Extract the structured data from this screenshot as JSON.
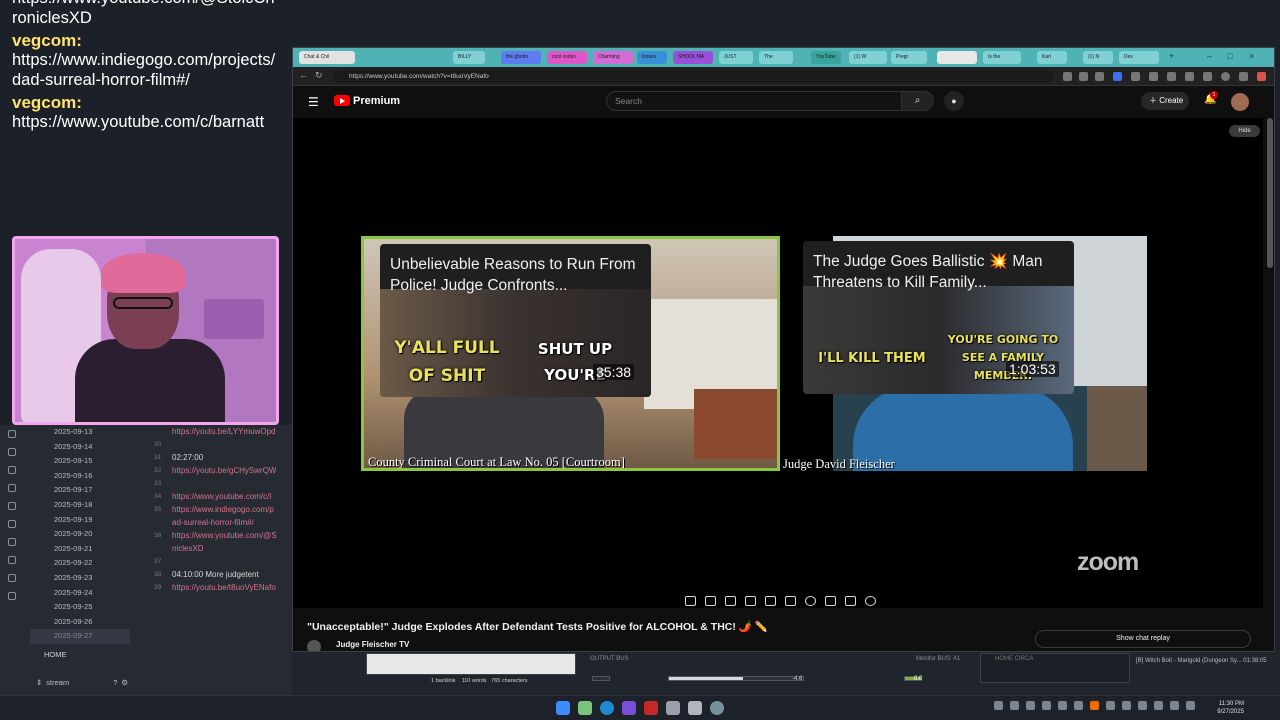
{
  "chat": {
    "messages": [
      {
        "user": "vegcom:",
        "text": "https://www.youtube.com/@StoicChroniclesXD"
      },
      {
        "user": "vegcom:",
        "text": "https://www.indiegogo.com/projects/dad-surreal-horror-film#/"
      },
      {
        "user": "vegcom:",
        "text": "https://www.youtube.com/c/barnatt"
      }
    ]
  },
  "notes": {
    "dates": [
      "2025-09-13",
      "2025-09-14",
      "2025-09-15",
      "2025-09-16",
      "2025-09-17",
      "2025-09-18",
      "2025-09-19",
      "2025-09-20",
      "2025-09-21",
      "2025-09-22",
      "2025-09-23",
      "2025-09-24",
      "2025-09-25",
      "2025-09-26",
      "2025-09-27"
    ],
    "home": "HOME",
    "footer": "stream",
    "lines": [
      {
        "n": "",
        "t": "https://youtu.be/LYYmuwOpd",
        "link": true
      },
      {
        "n": "30",
        "t": "",
        "link": false
      },
      {
        "n": "31",
        "t": "02:27:00",
        "link": false
      },
      {
        "n": "32",
        "t": "https://youtu.be/gCHySwrQW",
        "link": true
      },
      {
        "n": "33",
        "t": "",
        "link": false
      },
      {
        "n": "34",
        "t": "https://www.youtube.com/c/l",
        "link": false
      },
      {
        "n": "35",
        "t": "https://www.indiegogo.com/p",
        "link": false
      },
      {
        "n": "",
        "t": "ad-surreal-horror-film#/",
        "link": false
      },
      {
        "n": "36",
        "t": "https://www.youtube.com/@S",
        "link": false
      },
      {
        "n": "",
        "t": "niclesXD",
        "link": false
      },
      {
        "n": "37",
        "t": "",
        "link": false
      },
      {
        "n": "38",
        "t": "04:10:00 More judgetent",
        "link": false
      },
      {
        "n": "39",
        "t": "https://youtu.be/t8uoVyENafo",
        "link": true
      }
    ],
    "status": {
      "backlinks": "1 backlink",
      "words": "110 words",
      "chars": "765 characters"
    }
  },
  "obs": {
    "output_bus": "OUTPUT BUS",
    "monitor": "Monitor BUS: A1",
    "level_left": "-4.6",
    "level_right": "0.0",
    "track": "[B] Witch Bolt - Marigold (Dungeon Sy... 01:38:05",
    "scene": "HOME CIRCA"
  },
  "browser": {
    "tabs": [
      "Chat & Chil",
      "BILLY",
      "the ghetto",
      "cool codyo",
      "Charming",
      "Issues",
      "SHOOL MA",
      "JUST",
      "The",
      "YouTube",
      "(1) W",
      "Pregr",
      "Is the",
      "Karl",
      "(1) N",
      "Des"
    ],
    "url": "https://www.youtube.com/watch?v=t8uoVyENafo"
  },
  "youtube": {
    "brand": "Premium",
    "search_placeholder": "Search",
    "create_label": "Create",
    "notif_count": "1",
    "hide_label": "Hide",
    "video_title": "\"Unacceptable!\" Judge Explodes After Defendant Tests Positive for ALCOHOL & THC! 🌶️ ✏️",
    "channel": "Judge Fleischer TV",
    "chat_replay": "Show chat replay",
    "zoom_logo": "zoom"
  },
  "video": {
    "left": {
      "thumb_title": "Unbelievable Reasons to Run From Police! Judge Confronts...",
      "cap1": "Y'ALL FULL OF SHIT",
      "cap2": "SHUT UP YOU'RE",
      "duration": "35:38",
      "label": "County Criminal Court at Law No. 05 [Courtroom]"
    },
    "right": {
      "thumb_title": "The Judge Goes Ballistic 💥 Man Threatens to Kill Family...",
      "cap1": "I'LL KILL THEM",
      "cap2": "YOU'RE GOING TO SEE A FAMILY MEMBER.",
      "duration": "1:03:53",
      "label": "Judge David Fleischer"
    }
  },
  "taskbar": {
    "time": "11:30 PM",
    "date": "9/27/2025"
  },
  "colors": {
    "accent_green": "#8cc63f",
    "yt_red": "#ff0000",
    "chat_user": "#ffe36e",
    "tab_strip": "#4fb3b6"
  }
}
